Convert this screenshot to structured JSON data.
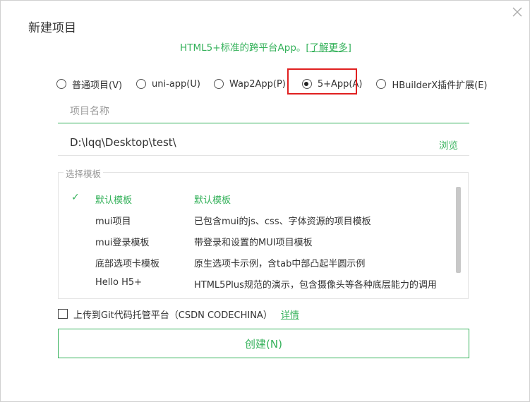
{
  "dialog": {
    "title": "新建项目",
    "close_icon": "close-icon"
  },
  "subtitle": {
    "text": "HTML5+标准的跨平台App。",
    "link": "[了解更多]"
  },
  "project_types": [
    {
      "label": "普通项目(V)",
      "checked": false
    },
    {
      "label": "uni-app(U)",
      "checked": false
    },
    {
      "label": "Wap2App(P)",
      "checked": false
    },
    {
      "label": "5+App(A)",
      "checked": true
    },
    {
      "label": "HBuilderX插件扩展(E)",
      "checked": false
    }
  ],
  "name_field": {
    "value": "",
    "placeholder": "项目名称"
  },
  "location": {
    "path": "D:\\lqq\\Desktop\\test\\",
    "browse_label": "浏览"
  },
  "templates": {
    "legend": "选择模板",
    "items": [
      {
        "name": "默认模板",
        "desc": "默认模板",
        "selected": true
      },
      {
        "name": "mui项目",
        "desc": "已包含mui的js、css、字体资源的项目模板",
        "selected": false
      },
      {
        "name": "mui登录模板",
        "desc": "带登录和设置的MUI项目模板",
        "selected": false
      },
      {
        "name": "底部选项卡模板",
        "desc": "原生选项卡示例，含tab中部凸起半圆示例",
        "selected": false
      },
      {
        "name": "Hello H5+",
        "desc": "HTML5Plus规范的演示，包含摄像头等各种底层能力的调用",
        "selected": false
      }
    ]
  },
  "git": {
    "label": "上传到Git代码托管平台（CSDN CODECHINA）",
    "detail_link": "详情",
    "checked": false
  },
  "create_button": {
    "label": "创建(N)"
  },
  "colors": {
    "accent": "#34b15a",
    "highlight_border": "#e02020"
  }
}
